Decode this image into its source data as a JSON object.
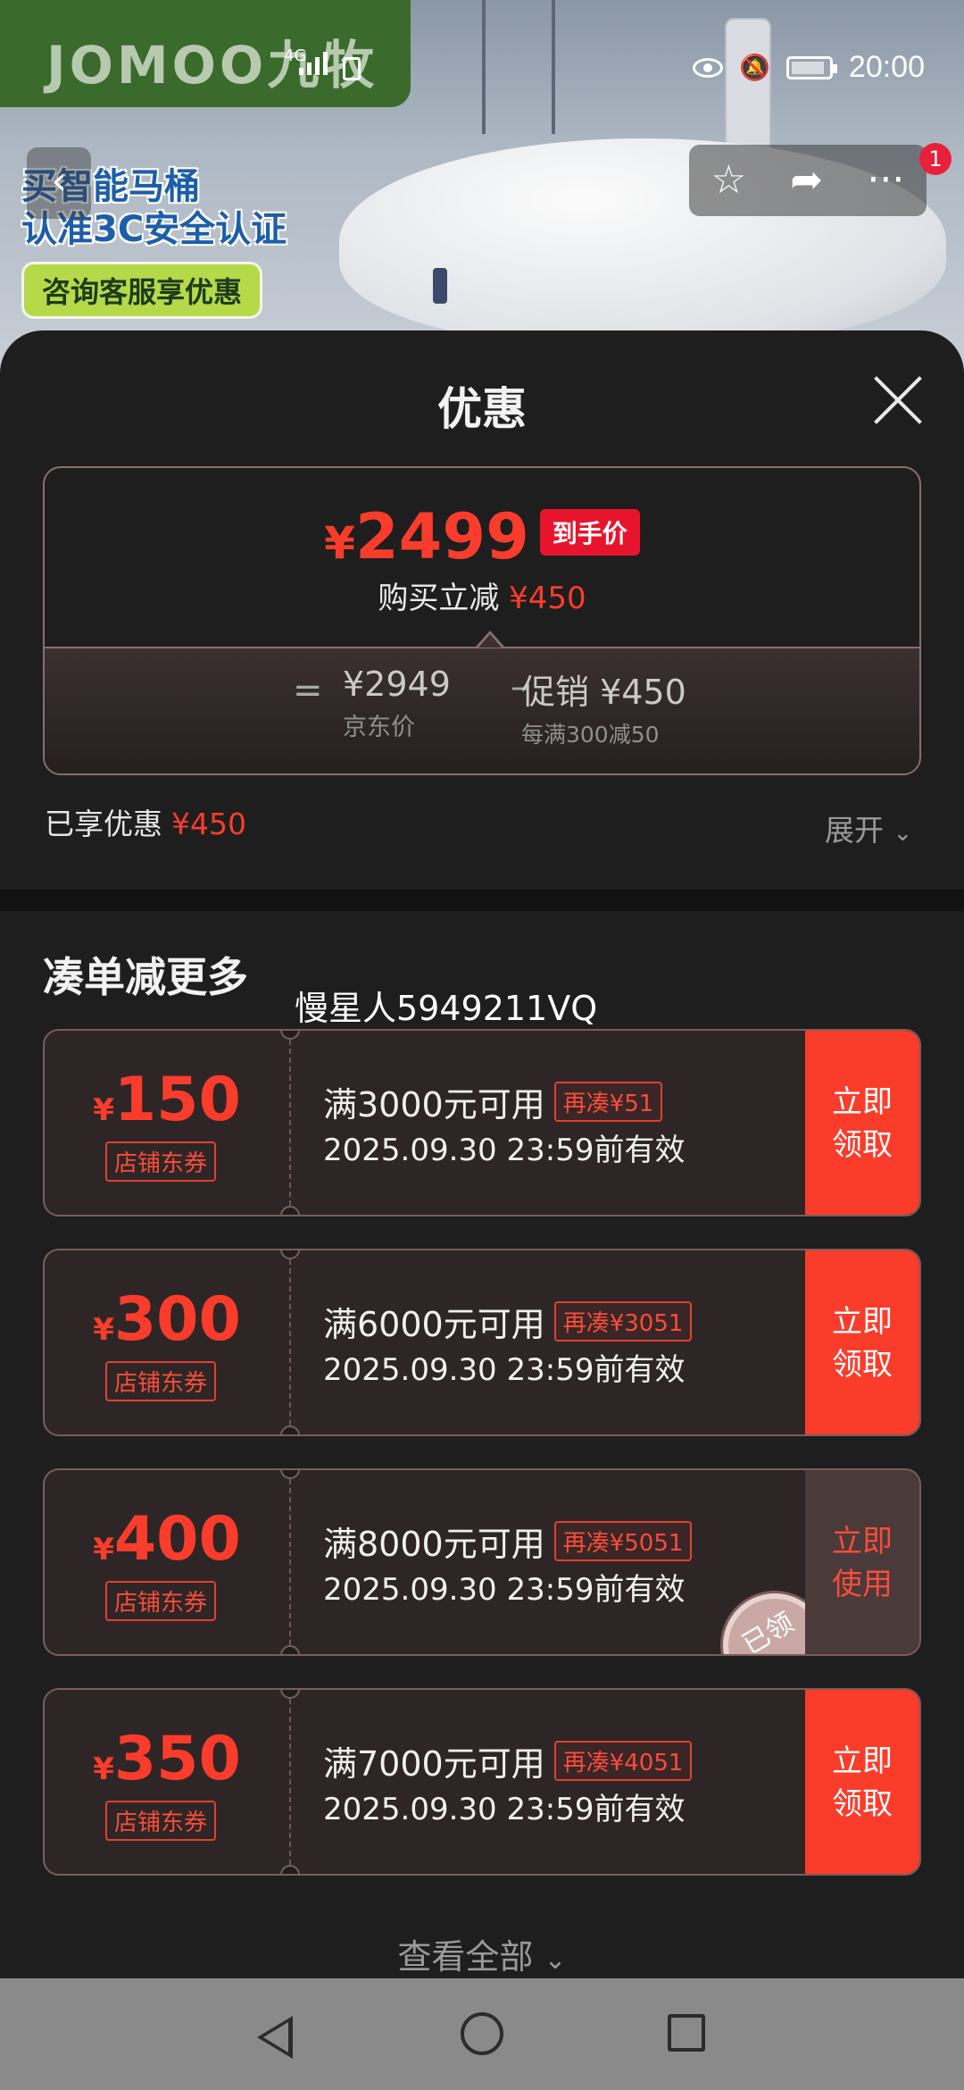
{
  "status_bar": {
    "network": "4G",
    "time": "20:00"
  },
  "background": {
    "brand_logo": "JOMOO九牧",
    "promo_line1": "买智能马桶",
    "promo_line2": "认准3C安全认证",
    "promo_button": "咨询客服享优惠",
    "cart_badge": "1"
  },
  "sheet": {
    "title": "优惠",
    "price": {
      "currency": "¥",
      "final_price": "2499",
      "final_tag": "到手价",
      "reduce_label": "购买立减",
      "reduce_value": "¥450",
      "equals": "=",
      "jd_price_value": "¥2949",
      "jd_price_label": "京东价",
      "minus": "–",
      "promo_value": "促销 ¥450",
      "promo_desc": "每满300减50"
    },
    "enjoyed_label": "已享优惠",
    "enjoyed_value": "¥450",
    "expand_label": "展开",
    "more_title": "凑单减更多",
    "user_tag": "慢星人5949211VQ",
    "coupons": [
      {
        "yen": "¥",
        "amount": "150",
        "type": "店铺东券",
        "condition": "满3000元可用",
        "need": "再凑¥51",
        "valid": "2025.09.30 23:59前有效",
        "btn_line1": "立即",
        "btn_line2": "领取"
      },
      {
        "yen": "¥",
        "amount": "300",
        "type": "店铺东券",
        "condition": "满6000元可用",
        "need": "再凑¥3051",
        "valid": "2025.09.30 23:59前有效",
        "btn_line1": "立即",
        "btn_line2": "领取"
      },
      {
        "yen": "¥",
        "amount": "400",
        "type": "店铺东券",
        "condition": "满8000元可用",
        "need": "再凑¥5051",
        "valid": "2025.09.30 23:59前有效",
        "btn_line1": "立即",
        "btn_line2": "使用",
        "stamp": "已领"
      },
      {
        "yen": "¥",
        "amount": "350",
        "type": "店铺东券",
        "condition": "满7000元可用",
        "need": "再凑¥4051",
        "valid": "2025.09.30 23:59前有效",
        "btn_line1": "立即",
        "btn_line2": "领取"
      }
    ],
    "view_all": "查看全部"
  },
  "colors": {
    "accent_red": "#fa3c2c",
    "sheet_bg": "#1e1e1e",
    "coupon_bg": "#2e2626"
  }
}
